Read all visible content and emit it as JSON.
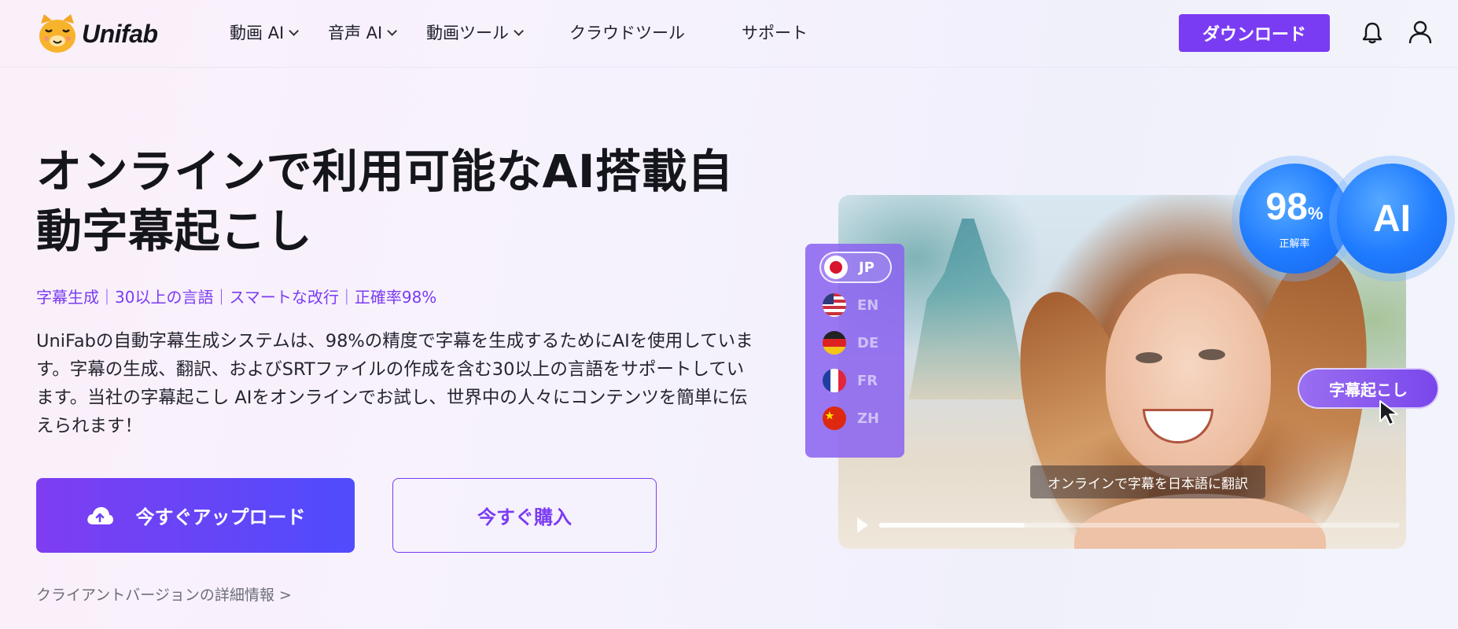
{
  "header": {
    "logo_text": "Unifab",
    "nav": [
      {
        "label": "動画 AI",
        "has_dropdown": true
      },
      {
        "label": "音声 AI",
        "has_dropdown": true
      },
      {
        "label": "動画ツール",
        "has_dropdown": true
      },
      {
        "label": "クラウドツール",
        "has_dropdown": false
      },
      {
        "label": "サポート",
        "has_dropdown": false
      }
    ],
    "download_label": "ダウンロード",
    "icons": [
      "bell-icon",
      "user-icon"
    ]
  },
  "hero": {
    "title_line1": "オンラインで利用可能なAI搭載自",
    "title_line2": "動字幕起こし",
    "features": "字幕生成｜30以上の言語｜スマートな改行｜正確率98%",
    "description": "UniFabの自動字幕生成システムは、98%の精度で字幕を生成するためにAIを使用しています。字幕の生成、翻訳、およびSRTファイルの作成を含む30以上の言語をサポートしています。当社の字幕起こし AIをオンラインでお試し、世界中の人々にコンテンツを簡単に伝えられます！",
    "upload_label": "今すぐアップロード",
    "buy_label": "今すぐ購入",
    "client_link": "クライアントバージョンの詳細情報 >"
  },
  "visual": {
    "languages": [
      {
        "code": "JP",
        "active": true
      },
      {
        "code": "EN",
        "active": false
      },
      {
        "code": "DE",
        "active": false
      },
      {
        "code": "FR",
        "active": false
      },
      {
        "code": "ZH",
        "active": false
      }
    ],
    "badge_accuracy_value": "98",
    "badge_accuracy_unit": "%",
    "badge_accuracy_label": "正解率",
    "badge_ai": "AI",
    "subtitle_chip": "字幕起こし",
    "caption": "オンラインで字幕を日本語に翻訳",
    "video_progress": 0.28
  },
  "colors": {
    "accent": "#7a3cf3",
    "badge_blue": "#1f7bff"
  }
}
